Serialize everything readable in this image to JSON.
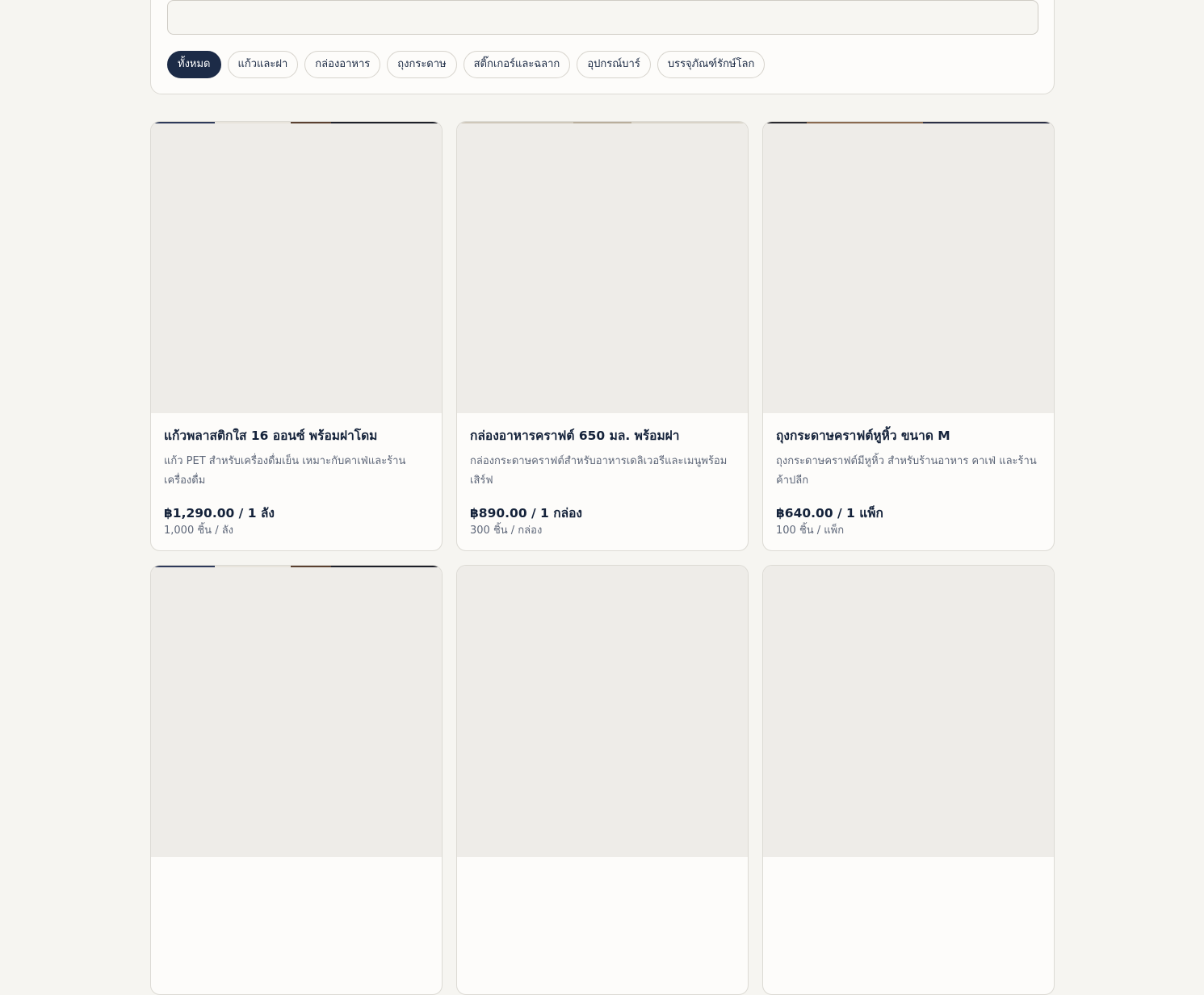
{
  "search": {
    "placeholder": "",
    "value": ""
  },
  "categories": [
    {
      "label": "ทั้งหมด",
      "active": true
    },
    {
      "label": "แก้วและฝา",
      "active": false
    },
    {
      "label": "กล่องอาหาร",
      "active": false
    },
    {
      "label": "ถุงกระดาษ",
      "active": false
    },
    {
      "label": "สติ๊กเกอร์และฉลาก",
      "active": false
    },
    {
      "label": "อุปกรณ์บาร์",
      "active": false
    },
    {
      "label": "บรรจุภัณฑ์รักษ์โลก",
      "active": false
    }
  ],
  "products": [
    {
      "title": "แก้วพลาสติกใส 16 ออนซ์ พร้อมฝาโดม",
      "description": "แก้ว PET สำหรับเครื่องดื่มเย็น เหมาะกับคาเฟ่และร้านเครื่องดื่ม",
      "price": "฿1,290.00 / 1 ลัง",
      "unit": "1,000 ชิ้น / ลัง"
    },
    {
      "title": "กล่องอาหารคราฟต์ 650 มล. พร้อมฝา",
      "description": "กล่องกระดาษคราฟต์สำหรับอาหารเดลิเวอรีและเมนูพร้อมเสิร์ฟ",
      "price": "฿890.00 / 1 กล่อง",
      "unit": "300 ชิ้น / กล่อง"
    },
    {
      "title": "ถุงกระดาษคราฟต์หูหิ้ว ขนาด M",
      "description": "ถุงกระดาษคราฟต์มีหูหิ้ว สำหรับร้านอาหาร คาเฟ่ และร้านค้าปลีก",
      "price": "฿640.00 / 1 แพ็ก",
      "unit": "100 ชิ้น / แพ็ก"
    }
  ]
}
